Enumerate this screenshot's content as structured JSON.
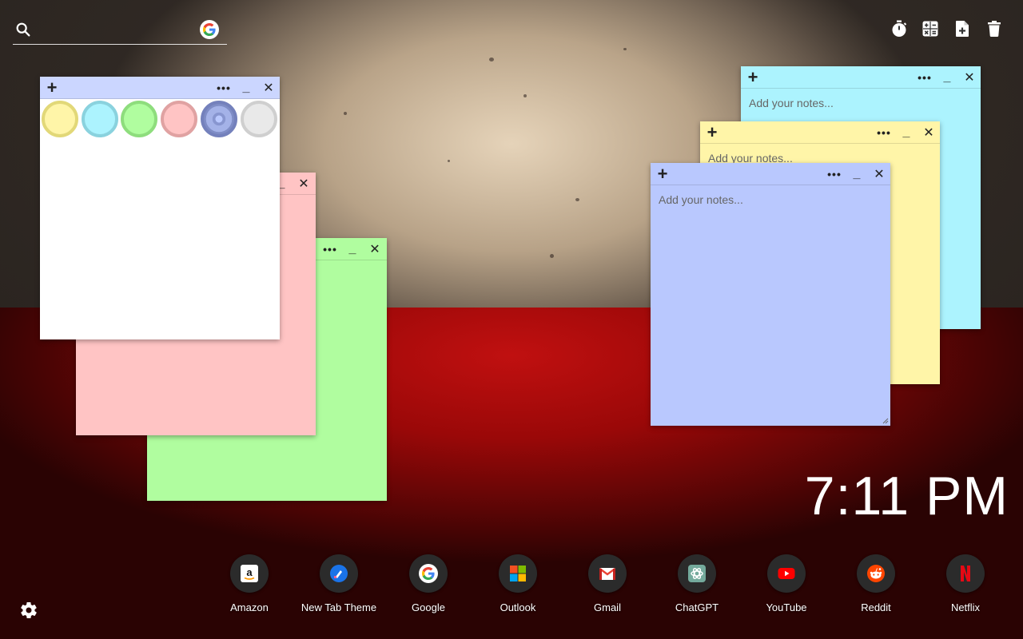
{
  "search": {
    "placeholder": ""
  },
  "toolbar": {
    "icons": [
      "timer-icon",
      "calculator-icon",
      "add-note-icon",
      "trash-icon"
    ]
  },
  "notes": {
    "placeholder": "Add your notes...",
    "menu_glyph": "•••",
    "minimize_glyph": "_",
    "close_glyph": "✕",
    "add_glyph": "+"
  },
  "colors": {
    "note_yellow": "#fff5a8",
    "note_blue": "#acf3fe",
    "note_green": "#b0fd9f",
    "note_pink": "#ffc4c4",
    "note_purple": "#b9c8fe",
    "note_white": "#ffffff",
    "header_purple": "#cbd6ff"
  },
  "color_picker": {
    "swatches": [
      "yellow",
      "blue",
      "green",
      "pink",
      "purple",
      "white"
    ]
  },
  "clock": {
    "time": "7:11 PM"
  },
  "shortcuts": [
    {
      "label": "Amazon",
      "icon": "amazon-icon"
    },
    {
      "label": "New Tab Theme",
      "icon": "new-tab-theme-icon"
    },
    {
      "label": "Google",
      "icon": "google-icon"
    },
    {
      "label": "Outlook",
      "icon": "outlook-icon"
    },
    {
      "label": "Gmail",
      "icon": "gmail-icon"
    },
    {
      "label": "ChatGPT",
      "icon": "chatgpt-icon"
    },
    {
      "label": "YouTube",
      "icon": "youtube-icon"
    },
    {
      "label": "Reddit",
      "icon": "reddit-icon"
    },
    {
      "label": "Netflix",
      "icon": "netflix-icon"
    }
  ]
}
